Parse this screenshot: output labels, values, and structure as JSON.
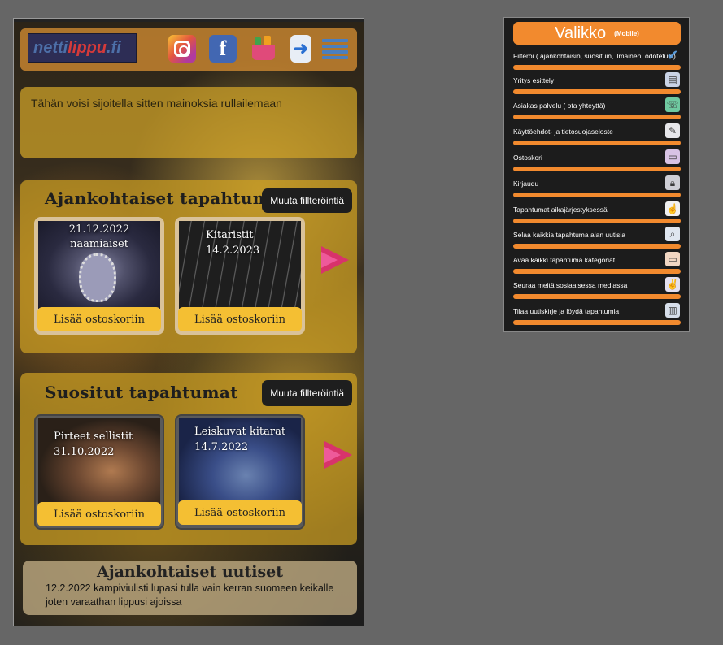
{
  "header": {
    "logo_part1": "netti",
    "logo_part2": "lippu",
    "logo_part3": ".fi",
    "icons": [
      "instagram-icon",
      "facebook-icon",
      "shopping-basket-icon",
      "login-icon",
      "menu-list-icon"
    ]
  },
  "ad": {
    "text": "Tähän voisi sijoitella sitten  mainoksia rullailemaan"
  },
  "current": {
    "title": "Ajankohtaiset tapahtumat",
    "filter_label": "Muuta fillteröintiä",
    "cards": [
      {
        "line1": "21.12.2022",
        "line2": "naamiaiset",
        "buy_label": "Lisää ostoskoriin"
      },
      {
        "line1": "Kitaristit",
        "line2": "14.2.2023",
        "buy_label": "Lisää ostoskoriin"
      }
    ]
  },
  "popular": {
    "title": "Suositut tapahtumat",
    "filter_label": "Muuta fillteröintiä",
    "cards": [
      {
        "line1": "Pirteet sellistit",
        "line2": "31.10.2022",
        "buy_label": "Lisää ostoskoriin"
      },
      {
        "line1": "Leiskuvat kitarat",
        "line2": "14.7.2022",
        "buy_label": "Lisää ostoskoriin"
      }
    ]
  },
  "news": {
    "title": "Ajankohtaiset uutiset",
    "line1": "12.2.2022 kampiviulisti lupasi tulla vain kerran suomeen keikalle",
    "line2": "joten varaathan lippusi ajoissa"
  },
  "menu": {
    "title": "Valikko",
    "subtitle": "(Mobile)",
    "items": [
      {
        "label": "Filteröi ( ajankohtaisin, suosituin, ilmainen, odotetuin)",
        "icon": "checkmark-icon"
      },
      {
        "label": "Yritys esittely",
        "icon": "company-card-icon"
      },
      {
        "label": "Asiakas palvelu ( ota yhteyttä)",
        "icon": "phone-icon"
      },
      {
        "label": "Käyttöehdot- ja tietosuojaseloste",
        "icon": "document-icon"
      },
      {
        "label": "Ostoskori",
        "icon": "folder-icon"
      },
      {
        "label": "Kirjaudu",
        "icon": "lock-icon"
      },
      {
        "label": "Tapahtumat aikajärjestyksessä",
        "icon": "pointer-hand-icon"
      },
      {
        "label": "Selaa kaikkia tapahtuma alan uutisia",
        "icon": "magnifier-icon"
      },
      {
        "label": "Avaa kaikki tapahtuma kategoriat",
        "icon": "folder-open-icon"
      },
      {
        "label": "Seuraa meitä sosiaalsessa mediassa",
        "icon": "peace-hand-icon"
      },
      {
        "label": "Tilaa uutiskirje ja löydä tapahtumia",
        "icon": "newsletter-icon"
      }
    ]
  }
}
